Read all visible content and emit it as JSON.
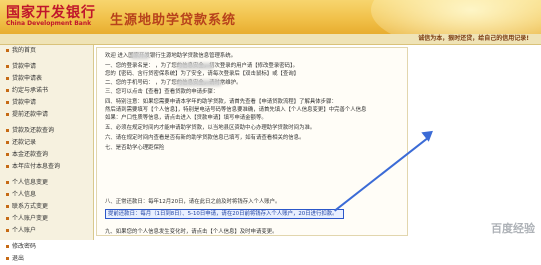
{
  "header": {
    "bank_name_zh": "国家开发银行",
    "bank_name_en": "China Development Bank",
    "system_title": "生源地助学贷款系统",
    "slogan": "诚信为本，狠时还贷，给自己的信用记录!"
  },
  "sidebar": {
    "items": [
      "我的首页",
      "贷款申请",
      "贷款申请表",
      "约定与承诺书",
      "贷款申请",
      "提前还款申请",
      "",
      "贷款及还款查询",
      "还款记录",
      "本金还款查询",
      "本年应付本息查询",
      "",
      "个人信息变更",
      "个人信息",
      "联系方式变更",
      "个人账户变更",
      "个人账户",
      "",
      "修改密码",
      "退出"
    ]
  },
  "content": {
    "greeting": "欢迎      进入国家开发银行生源地助学贷款信息管理系统。",
    "lines": [
      "一、您的登录名是：          ，为了您的信息安全，初次登录的用户请【修改登录密码】。",
      "    您的【密码、含行贷密保系统】为了安全，请每次登录后【双击鼠标】或【查询】",
      "二、您的手机号码：              ，为了您的信息安全，请时常维护。",
      "三、您可以点击【查看】查看贷款的申请步骤：",
      "四、特别注意：如果您需要申请本学年的助学贷款，请首先查看【申请贷款流程】了解具体步骤：",
      "    然后请到需要填写【个人信息】，特别是电话号码等信息要准确，请首先填入【个人信息变更】中完善个人信息",
      "    如果：户口性质等信息，请点击进入【贷款申请】填写申请金额等。",
      "五、必须在规定时间内才能申请助学贷款，以当地县区资助中心办理助学贷款时间为准。",
      "六、请在规定时间内查看是否有新的助学贷款信息已填写，如有请查看相关的信息。",
      "七、是否助学心理距保险",
      "八、正常还款日：每年12月20日，请在此日之前及时将钱存入个人账户。",
      "九、如果您的个人信息发生变化时，请点击【个人信息】及时申请变更。"
    ],
    "highlight": "提前还款日：每月（1日到8日）、5-10日申请，请在20日前将钱存入个人账户，20日进行扣款。",
    "watermark": "百度经验"
  },
  "colors": {
    "brand_red": "#c0152b",
    "header_gold": "#f1c14a",
    "highlight_blue": "#2c57c9"
  }
}
